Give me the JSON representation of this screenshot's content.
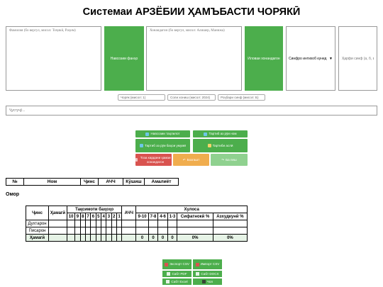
{
  "title": "Системаи АРЗЁБИИ ҲАМЪБАСТИ ЧОРЯКӢ",
  "names_field": {
    "placeholder": "Фамилия (бо вергул, мисол: Тоҷикӣ, Раҳим)"
  },
  "add_names_button": "Навсозии фанҳо",
  "grades_field": {
    "placeholder": "Хонандагон (бо вергул, мисол: Алишер, Манижа)"
  },
  "add_students_button": "Иловаи хонандагон",
  "gender_select": {
    "selected": "Синфро интихоб кунед"
  },
  "letter_field": {
    "placeholder": "Ҳарфи синф (а, б, в)"
  },
  "quarter_field": {
    "placeholder": "Чоряк (мисол: 1)"
  },
  "year_field": {
    "placeholder": "Соли хониш (мисол: 2024)"
  },
  "class_field": {
    "placeholder": "Роҳбари синф (мисол: Б)"
  },
  "search": {
    "placeholder": "Ҷустуҷӯ..."
  },
  "actions": {
    "update_analysis": "Навсозии таҳлилот",
    "sort_by_name": "Тартиб аз рӯи ном",
    "sort_by_grade": "Тартиб аз рӯи баҳои умумӣ",
    "sort_by_class": "Тартиби аслӣ",
    "clear_all": "Тоза кардани ҳамаи хонандагон",
    "undo": "Бозгашт",
    "redo": "Ба пеш"
  },
  "students_table": {
    "headers": [
      "№",
      "Ном",
      "Ҷинс",
      "АЧЧ",
      "Кӯшиш",
      "Амалиёт"
    ]
  },
  "stats": {
    "title": "Омор",
    "gender_header": "Ҷинс",
    "total_header": "Ҳамагӣ",
    "grades_group": "Тақсимоти баҳоҳо",
    "avg_header": "АЧЧ",
    "result_group": "Хулоса",
    "grade_cols": [
      "10",
      "9",
      "8",
      "7",
      "6",
      "5",
      "4",
      "3",
      "2",
      "1"
    ],
    "range_cols": [
      "9-10",
      "7-8",
      "4-6",
      "1-3"
    ],
    "quality_header": "Сифатнокӣ %",
    "success_header": "Азхудкунӣ %",
    "rows": [
      {
        "label": "Духтарон"
      },
      {
        "label": "Писарон"
      },
      {
        "label": "Ҳамагӣ",
        "ranges": [
          "0",
          "0",
          "0",
          "0"
        ],
        "quality": "0%",
        "success": "0%"
      }
    ]
  },
  "export": {
    "export_csv": "Экспорт CSV",
    "import_csv": "Импорт CSV",
    "save_pdf": "Сабт PDF",
    "save_docx": "Сабт DOCX",
    "save_excel": "Сабт Excel",
    "print": "Чоп"
  },
  "colors": {
    "green": "#4cae4c",
    "red": "#d9534f",
    "orange": "#f0ad4e",
    "light_green": "#8fd18f"
  }
}
